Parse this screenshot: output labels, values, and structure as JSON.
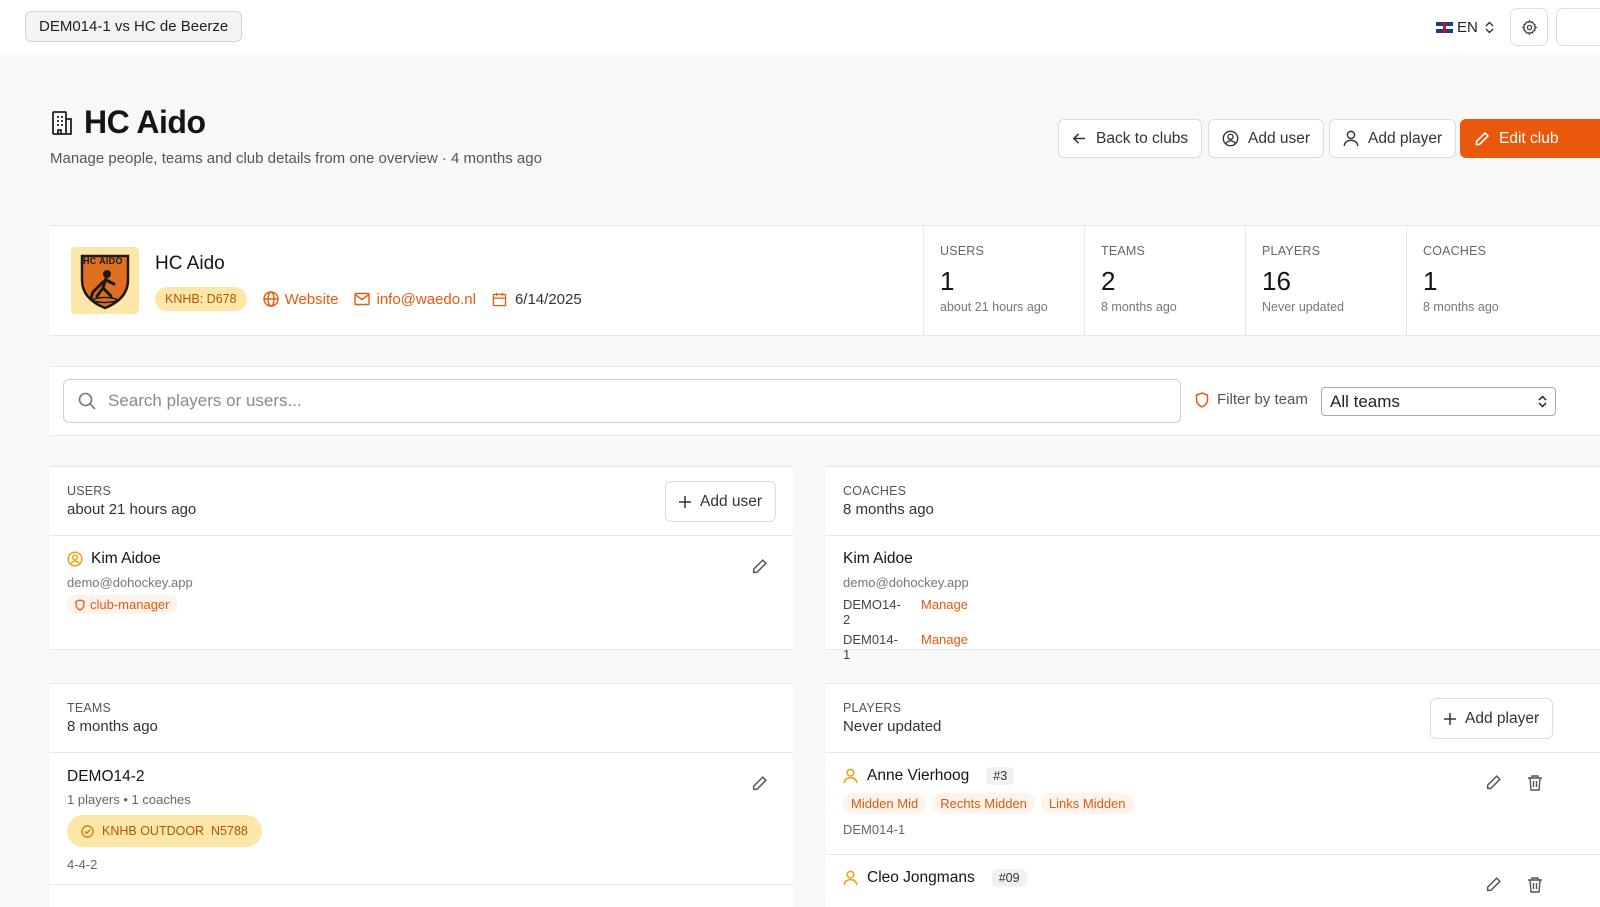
{
  "topbar": {
    "match_label": "DEM014-1 vs HC de Beerze",
    "language": "EN",
    "flag_icon": "uk-flag-icon"
  },
  "header": {
    "title": "HC Aido",
    "subtitle": "Manage people, teams and club details from one overview · 4 months ago",
    "buttons": {
      "back": "Back to clubs",
      "add_user": "Add user",
      "add_player": "Add player",
      "edit_club": "Edit club"
    }
  },
  "club": {
    "name": "HC Aido",
    "logo_text": "HC AIDO",
    "knhb": "KNHB: D678",
    "website": "Website",
    "email": "info@waedo.nl",
    "date": "6/14/2025"
  },
  "stats": [
    {
      "label": "USERS",
      "value": "1",
      "sub": "about 21 hours ago"
    },
    {
      "label": "TEAMS",
      "value": "2",
      "sub": "8 months ago"
    },
    {
      "label": "PLAYERS",
      "value": "16",
      "sub": "Never updated"
    },
    {
      "label": "COACHES",
      "value": "1",
      "sub": "8 months ago"
    }
  ],
  "search": {
    "placeholder": "Search players or users...",
    "filter_label": "Filter by team",
    "team_selected": "All teams"
  },
  "users_card": {
    "label": "USERS",
    "sub": "about 21 hours ago",
    "add_button": "Add user",
    "items": [
      {
        "name": "Kim Aidoe",
        "email": "demo@dohockey.app",
        "role": "club-manager"
      }
    ]
  },
  "coaches_card": {
    "label": "COACHES",
    "sub": "8 months ago",
    "items": [
      {
        "name": "Kim Aidoe",
        "email": "demo@dohockey.app",
        "teams": [
          {
            "team": "DEMO14-2",
            "action": "Manage"
          },
          {
            "team": "DEM014-1",
            "action": "Manage"
          }
        ]
      }
    ]
  },
  "teams_card": {
    "label": "TEAMS",
    "sub": "8 months ago",
    "items": [
      {
        "name": "DEMO14-2",
        "counts": "1 players • 1 coaches",
        "competition": "KNHB OUTDOOR  N5788",
        "formation": "4-4-2"
      }
    ]
  },
  "players_card": {
    "label": "PLAYERS",
    "sub": "Never updated",
    "add_button": "Add player",
    "items": [
      {
        "name": "Anne Vierhoog",
        "number": "#3",
        "positions": [
          "Midden Mid",
          "Rechts Midden",
          "Links Midden"
        ],
        "team": "DEM014-1"
      },
      {
        "name": "Cleo Jongmans",
        "number": "#09"
      }
    ]
  },
  "colors": {
    "accent": "#ea580c",
    "badge_bg": "#fde7a8",
    "badge_text": "#b45309"
  }
}
